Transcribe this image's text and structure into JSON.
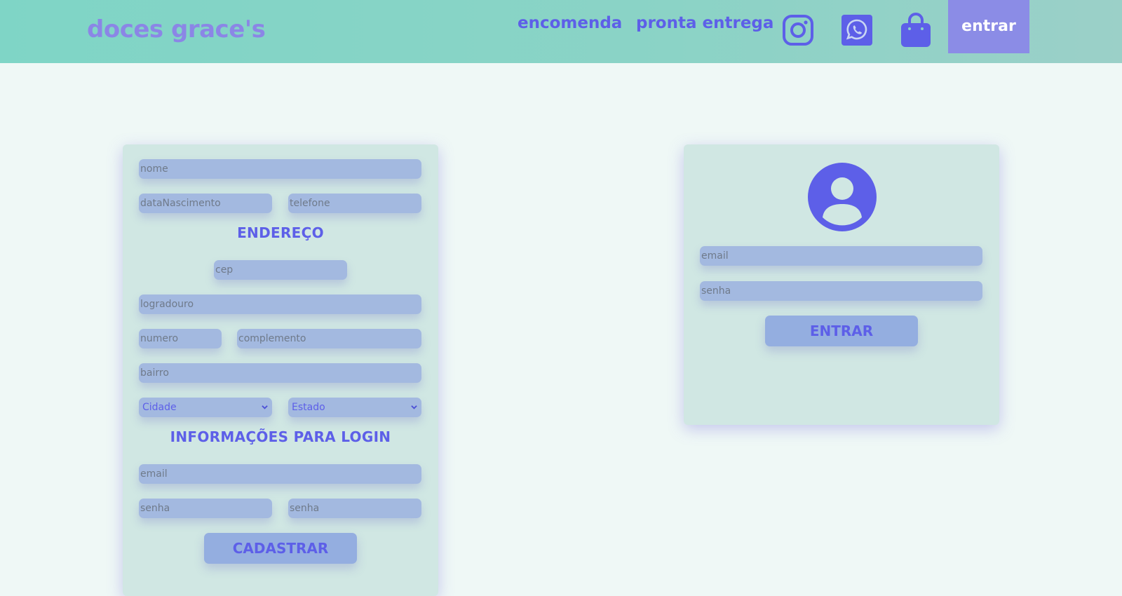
{
  "header": {
    "brand": "doces grace's",
    "nav": {
      "encomenda": "encomenda",
      "pronta_entrega": "pronta entrega"
    },
    "icons": [
      "instagram-icon",
      "whatsapp-icon",
      "shopping-bag-icon"
    ],
    "entrar_label": "entrar"
  },
  "register": {
    "nome_placeholder": "nome",
    "data_nascimento_placeholder": "dataNascimento",
    "telefone_placeholder": "telefone",
    "endereco_title": "ENDEREÇO",
    "cep_placeholder": "cep",
    "logradouro_placeholder": "logradouro",
    "numero_placeholder": "numero",
    "complemento_placeholder": "complemento",
    "bairro_placeholder": "bairro",
    "cidade_selected": "Cidade",
    "estado_selected": "Estado",
    "login_info_title": "INFORMAÇÕES PARA LOGIN",
    "email_placeholder": "email",
    "senha_placeholder": "senha",
    "senha_confirm_placeholder": "senha",
    "submit_label": "CADASTRAR"
  },
  "login": {
    "avatar_icon": "user-avatar-icon",
    "email_placeholder": "email",
    "senha_placeholder": "senha",
    "submit_label": "ENTRAR"
  },
  "colors": {
    "header_bg": "#7fd5c6",
    "accent": "#5d5fe8",
    "brand": "#8b86e6",
    "card_bg": "#d0e7e3",
    "field_bg": "#a3b9e0",
    "entrar_bg": "#8b8ce6"
  }
}
